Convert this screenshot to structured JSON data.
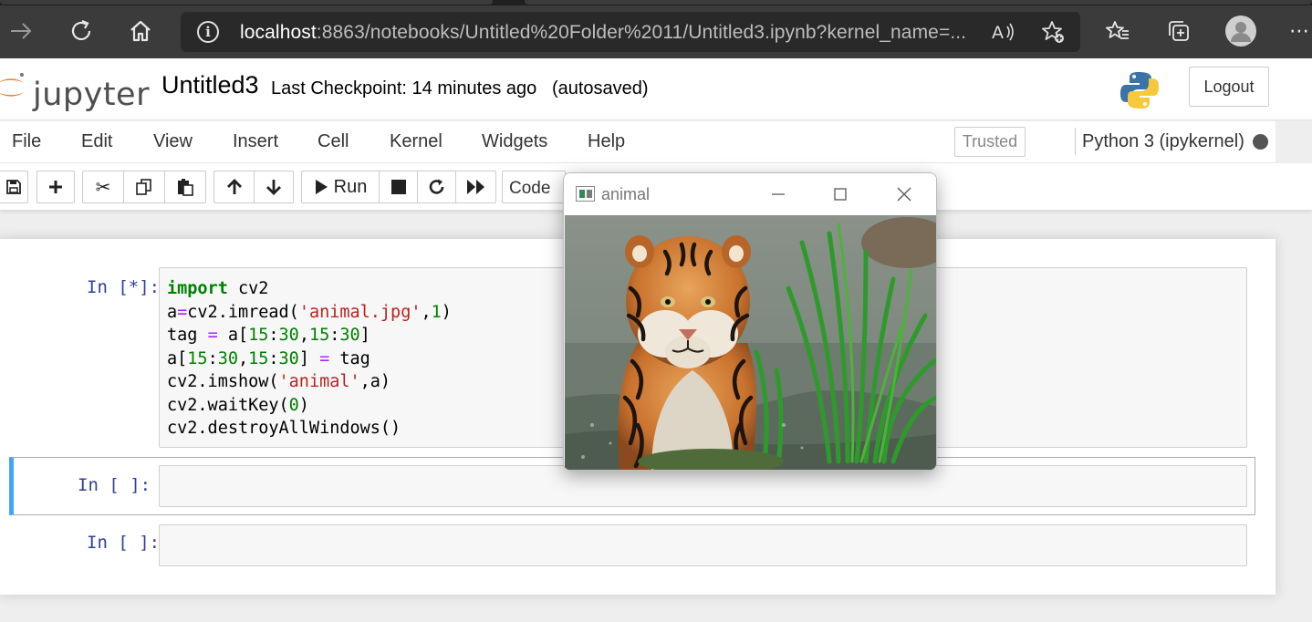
{
  "browser": {
    "url_host": "localhost",
    "url_rest": ":8863/notebooks/Untitled%20Folder%2011/Untitled3.ipynb?kernel_name=...",
    "icons": [
      "forward-icon",
      "refresh-icon",
      "home-icon",
      "info-icon",
      "read-aloud-icon",
      "add-favorite-icon",
      "favorites-icon",
      "collections-icon",
      "profile-icon",
      "more-icon"
    ]
  },
  "header": {
    "logo_text": "jupyter",
    "notebook_name": "Untitled3",
    "checkpoint": "Last Checkpoint: 14 minutes ago",
    "autosave": "(autosaved)",
    "logout_label": "Logout"
  },
  "menubar": {
    "items": [
      "File",
      "Edit",
      "View",
      "Insert",
      "Cell",
      "Kernel",
      "Widgets",
      "Help"
    ],
    "trusted_label": "Trusted",
    "kernel_label": "Python 3 (ipykernel)"
  },
  "toolbar": {
    "run_label": "Run",
    "cell_type": "Code"
  },
  "cells": [
    {
      "prompt": "In [*]:",
      "code_lines": [
        "import cv2",
        "a=cv2.imread('animal.jpg',1)",
        "tag = a[15:30,15:30]",
        "a[15:30,15:30] = tag",
        "cv2.imshow('animal',a)",
        "cv2.waitKey(0)",
        "cv2.destroyAllWindows()"
      ]
    },
    {
      "prompt": "In [ ]:",
      "code_lines": []
    },
    {
      "prompt": "In [ ]:",
      "code_lines": []
    }
  ],
  "popup": {
    "title": "animal",
    "image_subject": "tiger-in-water-photo"
  },
  "colors": {
    "selected_cell_accent": "#42a5f5",
    "prompt_color": "#303f9f",
    "keyword_color": "#008000",
    "string_color": "#ba2121",
    "operator_color": "#aa22ff"
  }
}
